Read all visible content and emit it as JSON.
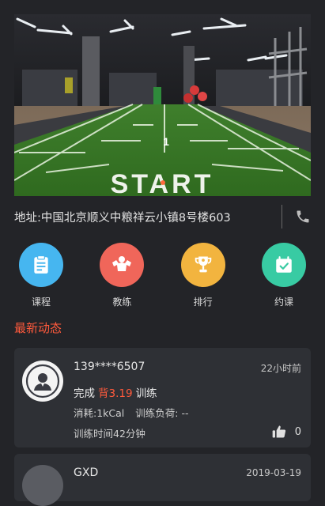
{
  "banner": {
    "floor_text": "START",
    "lane_number": "1"
  },
  "address": {
    "text": "地址:中国北京顺义中粮祥云小镇8号楼603"
  },
  "menu": {
    "items": [
      {
        "label": "课程",
        "color": "#46b6f0",
        "icon": "clipboard-icon"
      },
      {
        "label": "教练",
        "color": "#f0665a",
        "icon": "muscle-icon"
      },
      {
        "label": "排行",
        "color": "#f2b43f",
        "icon": "trophy-icon"
      },
      {
        "label": "约课",
        "color": "#38cba3",
        "icon": "calendar-check-icon"
      }
    ]
  },
  "feed": {
    "title": "最新动态",
    "posts": [
      {
        "user": "139****6507",
        "time": "22小时前",
        "action": "完成",
        "target": "背3.19",
        "suffix": "训练",
        "calories": "消耗:1kCal",
        "load": "训练负荷: --",
        "duration": "训练时间42分钟",
        "likes": "0"
      },
      {
        "user": "GXD",
        "time": "2019-03-19"
      }
    ]
  },
  "colors": {
    "background": "#232428",
    "card": "#2e3035",
    "accent": "#ff5a3c"
  }
}
